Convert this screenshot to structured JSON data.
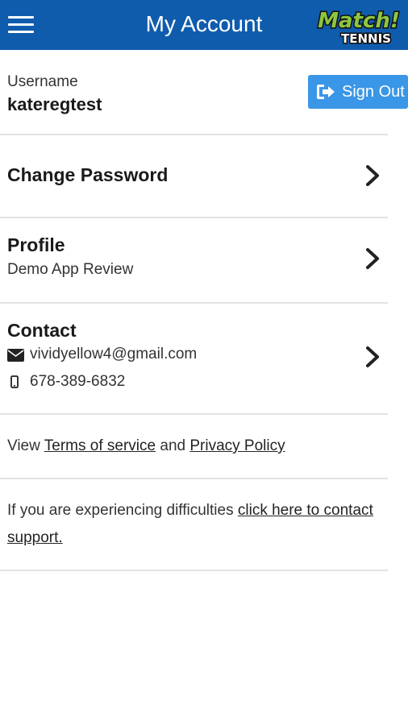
{
  "header": {
    "title": "My Account",
    "logo_top": "Match!",
    "logo_bottom": "TENNIS",
    "menu_icon": "hamburger-menu-icon",
    "bg_color": "#0f5cad"
  },
  "account": {
    "username_label": "Username",
    "username_value": "kateregtest",
    "sign_out_label": "Sign Out",
    "sign_out_icon": "sign-out-icon",
    "sign_out_color": "#3a96e6"
  },
  "menu": {
    "change_password_label": "Change Password",
    "profile_label": "Profile",
    "profile_value": "Demo App Review",
    "contact_label": "Contact",
    "contact_email": "vividyellow4@gmail.com",
    "contact_phone": "678-389-6832",
    "chevron_icon": "chevron-right-icon",
    "email_icon": "envelope-icon",
    "phone_icon": "mobile-phone-icon"
  },
  "legal": {
    "prefix": "View ",
    "terms_label": "Terms of service",
    "conjunction": " and ",
    "privacy_label": "Privacy Policy"
  },
  "support": {
    "text": "If you are experiencing difficulties ",
    "link_label": "click here to contact support."
  }
}
